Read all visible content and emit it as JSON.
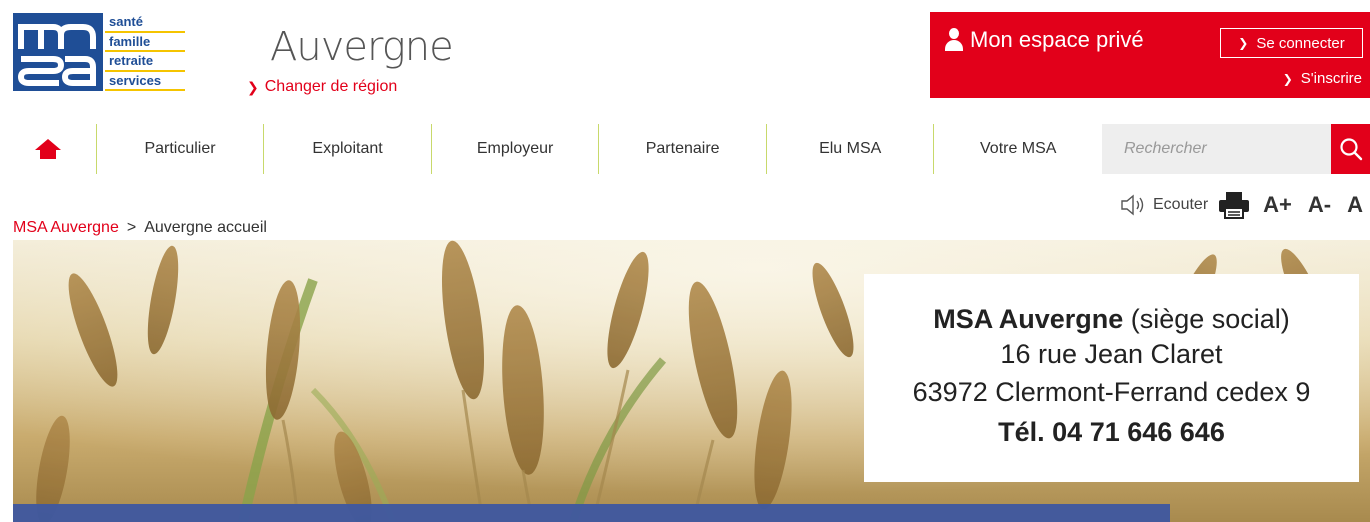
{
  "logo": {
    "lines": [
      "santé",
      "famille",
      "retraite",
      "services"
    ]
  },
  "region": {
    "title": "Auvergne",
    "change_label": "Changer de région"
  },
  "private_space": {
    "title": "Mon espace privé",
    "connect_label": "Se connecter",
    "signup_label": "S'inscrire"
  },
  "nav": {
    "items": [
      {
        "label": "Particulier"
      },
      {
        "label": "Exploitant"
      },
      {
        "label": "Employeur"
      },
      {
        "label": "Partenaire"
      },
      {
        "label": "Elu MSA"
      },
      {
        "label": "Votre MSA"
      }
    ]
  },
  "search": {
    "placeholder": "Rechercher"
  },
  "breadcrumb": {
    "link": "MSA Auvergne",
    "separator": ">",
    "current": "Auvergne accueil"
  },
  "tools": {
    "listen_label": "Ecouter",
    "font_increase": "A+",
    "font_decrease": "A-",
    "font_reset": "A"
  },
  "address": {
    "name": "MSA Auvergne",
    "name_suffix": " (siège social)",
    "street": "16 rue Jean Claret",
    "city": "63972 Clermont-Ferrand cedex 9",
    "phone": "Tél. 04 71 646 646"
  },
  "colors": {
    "brand_red": "#e2001a",
    "brand_blue": "#1f4e96",
    "nav_divider": "#c8d96b",
    "band_blue": "#3e57a0"
  }
}
